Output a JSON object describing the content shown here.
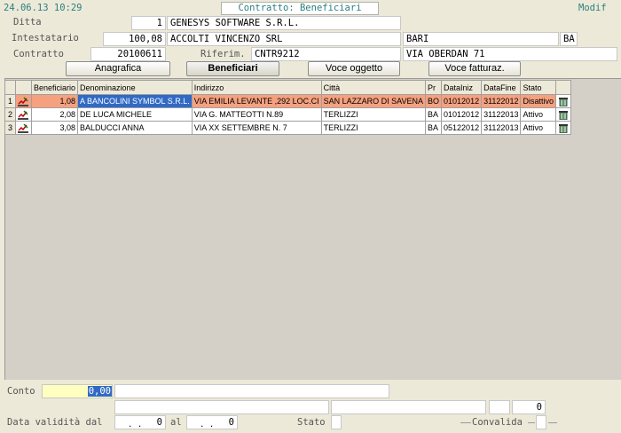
{
  "header": {
    "datetime": "24.06.13 10:29",
    "title": "Contratto: Beneficiari",
    "mode": "Modif"
  },
  "form": {
    "ditta_label": "Ditta",
    "ditta_code": "1",
    "ditta_name": "GENESYS SOFTWARE S.R.L.",
    "intestatario_label": "Intestatario",
    "intestatario_code": "100,08",
    "intestatario_name": "ACCOLTI VINCENZO SRL",
    "intestatario_city": "BARI",
    "intestatario_prov": "BA",
    "contratto_label": "Contratto",
    "contratto_code": "20100611",
    "riferim_label": "Riferim.",
    "riferim_value": "CNTR9212",
    "address": "VIA OBERDAN 71"
  },
  "tabs": [
    {
      "label": "Anagrafica"
    },
    {
      "label": "Beneficiari"
    },
    {
      "label": "Voce oggetto"
    },
    {
      "label": "Voce fatturaz."
    }
  ],
  "grid": {
    "columns": [
      "Beneficiario",
      "Denominazione",
      "Indirizzo",
      "Città",
      "Pr",
      "DataIniz",
      "DataFine",
      "Stato"
    ],
    "rows": [
      {
        "n": "1",
        "beneficiario": "1,08",
        "denominazione": "A BANCOLINI SYMBOL S.R.L.",
        "indirizzo": "VIA EMILIA LEVANTE ,292 LOC.CI",
        "citta": "SAN LAZZARO DI SAVENA",
        "pr": "BO",
        "data_iniz": "01012012",
        "data_fine": "31122012",
        "stato": "Disattivo"
      },
      {
        "n": "2",
        "beneficiario": "2,08",
        "denominazione": "DE LUCA MICHELE",
        "indirizzo": "VIA G. MATTEOTTI N.89",
        "citta": "TERLIZZI",
        "pr": "BA",
        "data_iniz": "01012012",
        "data_fine": "31122013",
        "stato": "Attivo"
      },
      {
        "n": "3",
        "beneficiario": "3,08",
        "denominazione": "BALDUCCI ANNA",
        "indirizzo": "VIA XX SETTEMBRE N. 7",
        "citta": "TERLIZZI",
        "pr": "BA",
        "data_iniz": "05122012",
        "data_fine": "31122013",
        "stato": "Attivo"
      }
    ]
  },
  "footer": {
    "conto_label": "Conto",
    "conto_value": "0,00",
    "small_value": "0",
    "data_label": "Data validità dal",
    "dal_date": ". .",
    "dal_num": "0",
    "al_label": "al",
    "al_date": ". .",
    "al_num": "0",
    "stato_label": "Stato",
    "convalida_label": "Convalida"
  },
  "colors": {
    "selected_row": "#f5a17f",
    "focus_cell": "#316ac5",
    "conto_field": "#ffffc0",
    "background": "#ece9d8"
  },
  "icons": {
    "row_edit": "pencil-chart-icon",
    "row_action": "recycle-bin-icon"
  }
}
